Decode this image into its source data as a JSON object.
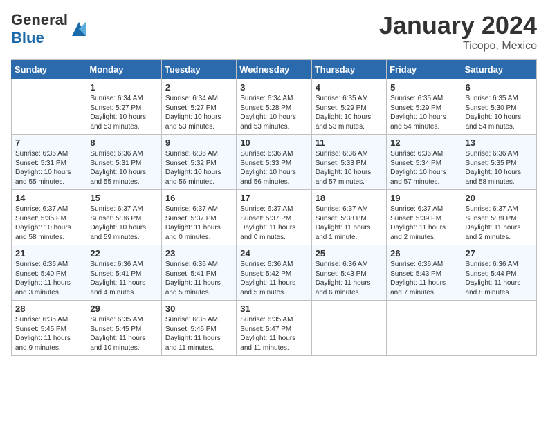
{
  "header": {
    "logo_general": "General",
    "logo_blue": "Blue",
    "month": "January 2024",
    "location": "Ticopo, Mexico"
  },
  "weekdays": [
    "Sunday",
    "Monday",
    "Tuesday",
    "Wednesday",
    "Thursday",
    "Friday",
    "Saturday"
  ],
  "weeks": [
    [
      {
        "num": "",
        "info": ""
      },
      {
        "num": "1",
        "info": "Sunrise: 6:34 AM\nSunset: 5:27 PM\nDaylight: 10 hours\nand 53 minutes."
      },
      {
        "num": "2",
        "info": "Sunrise: 6:34 AM\nSunset: 5:27 PM\nDaylight: 10 hours\nand 53 minutes."
      },
      {
        "num": "3",
        "info": "Sunrise: 6:34 AM\nSunset: 5:28 PM\nDaylight: 10 hours\nand 53 minutes."
      },
      {
        "num": "4",
        "info": "Sunrise: 6:35 AM\nSunset: 5:29 PM\nDaylight: 10 hours\nand 53 minutes."
      },
      {
        "num": "5",
        "info": "Sunrise: 6:35 AM\nSunset: 5:29 PM\nDaylight: 10 hours\nand 54 minutes."
      },
      {
        "num": "6",
        "info": "Sunrise: 6:35 AM\nSunset: 5:30 PM\nDaylight: 10 hours\nand 54 minutes."
      }
    ],
    [
      {
        "num": "7",
        "info": "Sunrise: 6:36 AM\nSunset: 5:31 PM\nDaylight: 10 hours\nand 55 minutes."
      },
      {
        "num": "8",
        "info": "Sunrise: 6:36 AM\nSunset: 5:31 PM\nDaylight: 10 hours\nand 55 minutes."
      },
      {
        "num": "9",
        "info": "Sunrise: 6:36 AM\nSunset: 5:32 PM\nDaylight: 10 hours\nand 56 minutes."
      },
      {
        "num": "10",
        "info": "Sunrise: 6:36 AM\nSunset: 5:33 PM\nDaylight: 10 hours\nand 56 minutes."
      },
      {
        "num": "11",
        "info": "Sunrise: 6:36 AM\nSunset: 5:33 PM\nDaylight: 10 hours\nand 57 minutes."
      },
      {
        "num": "12",
        "info": "Sunrise: 6:36 AM\nSunset: 5:34 PM\nDaylight: 10 hours\nand 57 minutes."
      },
      {
        "num": "13",
        "info": "Sunrise: 6:36 AM\nSunset: 5:35 PM\nDaylight: 10 hours\nand 58 minutes."
      }
    ],
    [
      {
        "num": "14",
        "info": "Sunrise: 6:37 AM\nSunset: 5:35 PM\nDaylight: 10 hours\nand 58 minutes."
      },
      {
        "num": "15",
        "info": "Sunrise: 6:37 AM\nSunset: 5:36 PM\nDaylight: 10 hours\nand 59 minutes."
      },
      {
        "num": "16",
        "info": "Sunrise: 6:37 AM\nSunset: 5:37 PM\nDaylight: 11 hours\nand 0 minutes."
      },
      {
        "num": "17",
        "info": "Sunrise: 6:37 AM\nSunset: 5:37 PM\nDaylight: 11 hours\nand 0 minutes."
      },
      {
        "num": "18",
        "info": "Sunrise: 6:37 AM\nSunset: 5:38 PM\nDaylight: 11 hours\nand 1 minute."
      },
      {
        "num": "19",
        "info": "Sunrise: 6:37 AM\nSunset: 5:39 PM\nDaylight: 11 hours\nand 2 minutes."
      },
      {
        "num": "20",
        "info": "Sunrise: 6:37 AM\nSunset: 5:39 PM\nDaylight: 11 hours\nand 2 minutes."
      }
    ],
    [
      {
        "num": "21",
        "info": "Sunrise: 6:36 AM\nSunset: 5:40 PM\nDaylight: 11 hours\nand 3 minutes."
      },
      {
        "num": "22",
        "info": "Sunrise: 6:36 AM\nSunset: 5:41 PM\nDaylight: 11 hours\nand 4 minutes."
      },
      {
        "num": "23",
        "info": "Sunrise: 6:36 AM\nSunset: 5:41 PM\nDaylight: 11 hours\nand 5 minutes."
      },
      {
        "num": "24",
        "info": "Sunrise: 6:36 AM\nSunset: 5:42 PM\nDaylight: 11 hours\nand 5 minutes."
      },
      {
        "num": "25",
        "info": "Sunrise: 6:36 AM\nSunset: 5:43 PM\nDaylight: 11 hours\nand 6 minutes."
      },
      {
        "num": "26",
        "info": "Sunrise: 6:36 AM\nSunset: 5:43 PM\nDaylight: 11 hours\nand 7 minutes."
      },
      {
        "num": "27",
        "info": "Sunrise: 6:36 AM\nSunset: 5:44 PM\nDaylight: 11 hours\nand 8 minutes."
      }
    ],
    [
      {
        "num": "28",
        "info": "Sunrise: 6:35 AM\nSunset: 5:45 PM\nDaylight: 11 hours\nand 9 minutes."
      },
      {
        "num": "29",
        "info": "Sunrise: 6:35 AM\nSunset: 5:45 PM\nDaylight: 11 hours\nand 10 minutes."
      },
      {
        "num": "30",
        "info": "Sunrise: 6:35 AM\nSunset: 5:46 PM\nDaylight: 11 hours\nand 11 minutes."
      },
      {
        "num": "31",
        "info": "Sunrise: 6:35 AM\nSunset: 5:47 PM\nDaylight: 11 hours\nand 11 minutes."
      },
      {
        "num": "",
        "info": ""
      },
      {
        "num": "",
        "info": ""
      },
      {
        "num": "",
        "info": ""
      }
    ]
  ]
}
